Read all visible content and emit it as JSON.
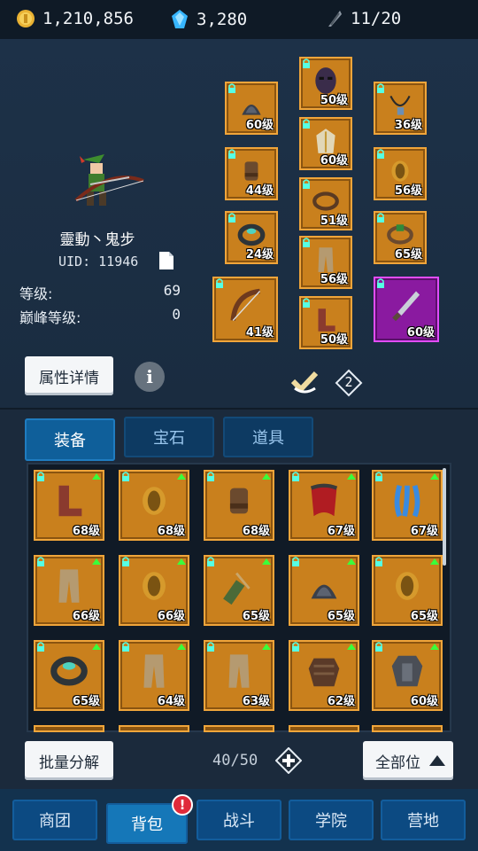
{
  "currencies": {
    "gold": "1,210,856",
    "gems": "3,280",
    "energy": "11/20"
  },
  "hero": {
    "name": "靈動丶鬼步",
    "uid": "UID: 11946",
    "level_label": "等级:",
    "level_value": "69",
    "peak_label": "巅峰等级:",
    "peak_value": "0"
  },
  "buttons": {
    "attr_details": "属性详情",
    "set_number": "2",
    "batch_decompose": "批量分解",
    "all_slots": "全部位"
  },
  "equipped": [
    {
      "level": "60级",
      "icon": "shoulder-armor-icon"
    },
    {
      "level": "50级",
      "icon": "mask-icon"
    },
    {
      "level": "36级",
      "icon": "necklace-icon"
    },
    {
      "level": "44级",
      "icon": "gloves-icon"
    },
    {
      "level": "60级",
      "icon": "robe-icon"
    },
    {
      "level": "56级",
      "icon": "bracer-icon"
    },
    {
      "level": "51级",
      "icon": "belt-icon"
    },
    {
      "level": "24级",
      "icon": "ring-icon"
    },
    {
      "level": "65级",
      "icon": "belt-buckle-icon"
    },
    {
      "level": "56级",
      "icon": "pants-icon"
    },
    {
      "level": "41级",
      "icon": "bow-icon"
    },
    {
      "level": "50级",
      "icon": "boots-icon"
    },
    {
      "level": "60级",
      "icon": "dagger-icon"
    }
  ],
  "tabs": [
    "装备",
    "宝石",
    "道具"
  ],
  "inventory": [
    {
      "level": "68级",
      "icon": "boots-icon"
    },
    {
      "level": "68级",
      "icon": "bracer-icon"
    },
    {
      "level": "68级",
      "icon": "gloves-icon"
    },
    {
      "level": "67级",
      "icon": "cape-icon"
    },
    {
      "level": "67级",
      "icon": "tentacle-icon"
    },
    {
      "level": "66级",
      "icon": "pants-icon"
    },
    {
      "level": "66级",
      "icon": "bracer-icon"
    },
    {
      "level": "65级",
      "icon": "quiver-icon"
    },
    {
      "level": "65级",
      "icon": "shoulder-armor-icon"
    },
    {
      "level": "65级",
      "icon": "bracer-icon"
    },
    {
      "level": "65级",
      "icon": "ring-icon"
    },
    {
      "level": "64级",
      "icon": "pants-icon"
    },
    {
      "level": "63级",
      "icon": "pants-icon"
    },
    {
      "level": "62级",
      "icon": "chest-armor-icon"
    },
    {
      "level": "60级",
      "icon": "plate-armor-icon"
    }
  ],
  "inventory_count": "40/50",
  "nav": [
    "商团",
    "背包",
    "战斗",
    "学院",
    "营地"
  ],
  "nav_badge": "!",
  "colors": {
    "slot_orange": "#c9801d",
    "slot_purple": "#8a1aa0",
    "tab_active": "#0f5f9a",
    "background": "#1b2a3c"
  }
}
